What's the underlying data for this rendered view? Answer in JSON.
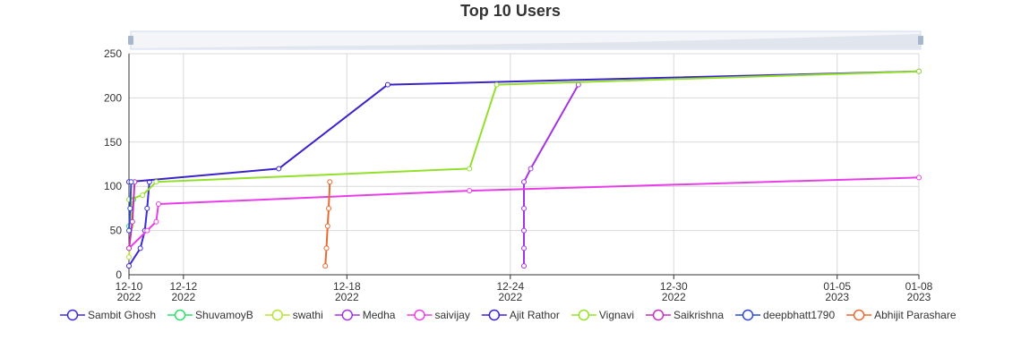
{
  "chart_data": {
    "type": "line",
    "title": "Top 10 Users",
    "xlabel": "",
    "ylabel": "",
    "ylim": [
      0,
      250
    ],
    "yticks": [
      0,
      50,
      100,
      150,
      200,
      250
    ],
    "xlim": [
      "2022-12-10",
      "2023-01-08"
    ],
    "xticks": [
      {
        "date": "2022-12-10",
        "line1": "12-10",
        "line2": "2022"
      },
      {
        "date": "2022-12-12",
        "line1": "12-12",
        "line2": "2022"
      },
      {
        "date": "2022-12-18",
        "line1": "12-18",
        "line2": "2022"
      },
      {
        "date": "2022-12-24",
        "line1": "12-24",
        "line2": "2022"
      },
      {
        "date": "2022-12-30",
        "line1": "12-30",
        "line2": "2022"
      },
      {
        "date": "2023-01-05",
        "line1": "01-05",
        "line2": "2023"
      },
      {
        "date": "2023-01-08",
        "line1": "01-08",
        "line2": "2023"
      }
    ],
    "grid": true,
    "legend_position": "bottom",
    "series": [
      {
        "name": "Sambit Ghosh",
        "color": "#3c2bd6",
        "points": [
          [
            "2022-12-10 00:00",
            10
          ],
          [
            "2022-12-10 10:00",
            30
          ],
          [
            "2022-12-10 14:00",
            50
          ],
          [
            "2022-12-10 16:00",
            75
          ],
          [
            "2022-12-10 18:00",
            105
          ]
        ]
      },
      {
        "name": "ShuvamoyB",
        "color": "#2ee06a",
        "points": [
          [
            "2022-12-10 00:00",
            55
          ],
          [
            "2022-12-10 04:00",
            85
          ]
        ]
      },
      {
        "name": "swathi",
        "color": "#b8e03a",
        "points": [
          [
            "2022-12-10 00:00",
            20
          ],
          [
            "2022-12-10 02:00",
            55
          ],
          [
            "2022-12-10 03:00",
            85
          ]
        ]
      },
      {
        "name": "Medha",
        "color": "#a335e0",
        "points": [
          [
            "2022-12-24 12:00",
            10
          ],
          [
            "2022-12-24 12:00",
            30
          ],
          [
            "2022-12-24 12:00",
            50
          ],
          [
            "2022-12-24 12:00",
            75
          ],
          [
            "2022-12-24 12:00",
            105
          ],
          [
            "2022-12-24 18:00",
            120
          ],
          [
            "2022-12-26 12:00",
            215
          ]
        ]
      },
      {
        "name": "saivijay",
        "color": "#e83ee8",
        "points": [
          [
            "2022-12-10 00:00",
            30
          ],
          [
            "2022-12-10 16:00",
            50
          ],
          [
            "2022-12-11 00:00",
            60
          ],
          [
            "2022-12-11 02:00",
            80
          ],
          [
            "2022-12-22 12:00",
            95
          ],
          [
            "2023-01-08 00:00",
            110
          ]
        ]
      },
      {
        "name": "Ajit Rathor",
        "color": "#3a22cc",
        "points": [
          [
            "2022-12-10 00:00",
            105
          ],
          [
            "2022-12-15 12:00",
            120
          ],
          [
            "2022-12-19 12:00",
            215
          ],
          [
            "2023-01-08 00:00",
            230
          ]
        ]
      },
      {
        "name": "Vignavi",
        "color": "#93e02a",
        "points": [
          [
            "2022-12-10 00:00",
            85
          ],
          [
            "2022-12-10 12:00",
            90
          ],
          [
            "2022-12-11 00:00",
            105
          ],
          [
            "2022-12-22 12:00",
            120
          ],
          [
            "2022-12-23 12:00",
            215
          ],
          [
            "2023-01-08 00:00",
            230
          ]
        ]
      },
      {
        "name": "Saikrishna",
        "color": "#c230c2",
        "points": [
          [
            "2022-12-10 00:00",
            30
          ],
          [
            "2022-12-10 03:00",
            60
          ],
          [
            "2022-12-10 05:00",
            105
          ]
        ]
      },
      {
        "name": "deepbhatt1790",
        "color": "#2f4ad0",
        "points": [
          [
            "2022-12-10 00:00",
            50
          ],
          [
            "2022-12-10 01:00",
            75
          ],
          [
            "2022-12-10 02:00",
            105
          ]
        ]
      },
      {
        "name": "Abhijit Parashare",
        "color": "#e86a2e",
        "points": [
          [
            "2022-12-17 05:00",
            10
          ],
          [
            "2022-12-17 06:00",
            30
          ],
          [
            "2022-12-17 07:00",
            55
          ],
          [
            "2022-12-17 08:00",
            75
          ],
          [
            "2022-12-17 09:00",
            105
          ]
        ]
      }
    ]
  }
}
